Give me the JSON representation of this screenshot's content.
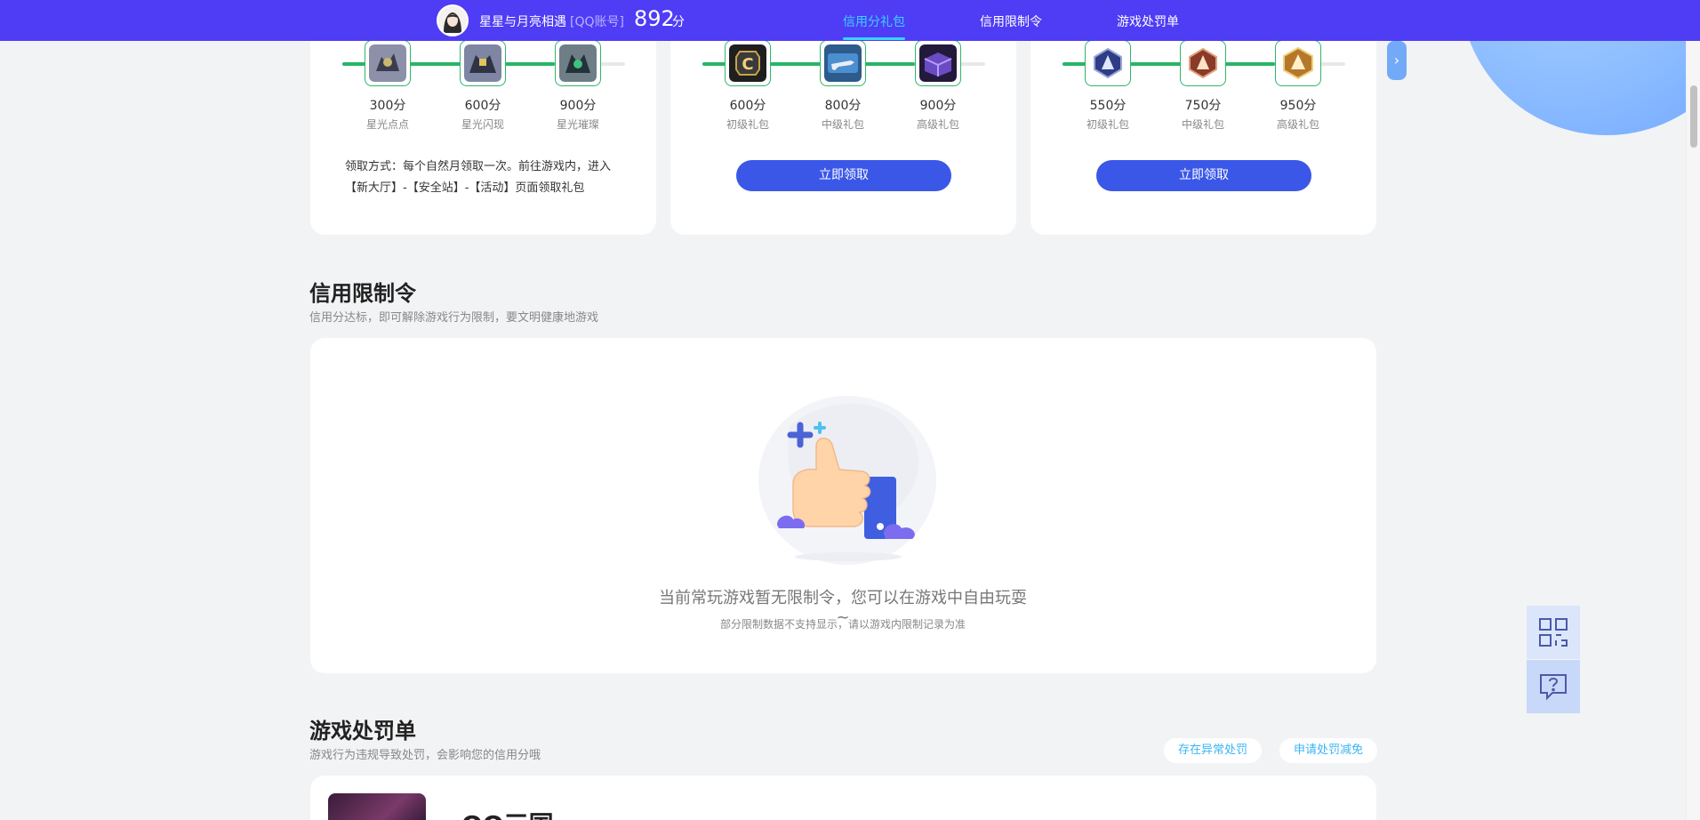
{
  "header": {
    "nickname": "星星与月亮相遇",
    "account_tag": "[QQ账号]",
    "score": "892",
    "score_unit": "分",
    "tabs": [
      {
        "label": "信用分礼包",
        "active": true
      },
      {
        "label": "信用限制令",
        "active": false
      },
      {
        "label": "游戏处罚单",
        "active": false
      }
    ]
  },
  "gift_cards": [
    {
      "items": [
        {
          "points": "300分",
          "label": "星光点点",
          "icon": "starlight-dot-icon",
          "color": "#6b6f85"
        },
        {
          "points": "600分",
          "label": "星光闪现",
          "icon": "starlight-flash-icon",
          "color": "#59607a"
        },
        {
          "points": "900分",
          "label": "星光璀璨",
          "icon": "starlight-dazzle-icon",
          "color": "#3f5a60"
        }
      ],
      "progress": 0.75,
      "note": "领取方式：每个自然月领取一次。前往游戏内，进入【新大厅】-【安全站】-【活动】页面领取礼包"
    },
    {
      "items": [
        {
          "points": "600分",
          "label": "初级礼包",
          "icon": "c-badge-icon",
          "color": "#2b2b2b"
        },
        {
          "points": "800分",
          "label": "中级礼包",
          "icon": "rifle-skin-icon",
          "color": "#2f6fa8"
        },
        {
          "points": "900分",
          "label": "高级礼包",
          "icon": "gift-crate-icon",
          "color": "#5a3f9a"
        }
      ],
      "progress": 0.75,
      "button": "立即领取"
    },
    {
      "items": [
        {
          "points": "550分",
          "label": "初级礼包",
          "icon": "blue-rank-badge-icon",
          "color": "#2f3c86"
        },
        {
          "points": "750分",
          "label": "中级礼包",
          "icon": "bronze-rank-badge-icon",
          "color": "#8a3a2a"
        },
        {
          "points": "950分",
          "label": "高级礼包",
          "icon": "gold-rank-badge-icon",
          "color": "#b5782b"
        }
      ],
      "progress": 0.75,
      "button": "立即领取"
    }
  ],
  "restriction": {
    "title": "信用限制令",
    "subtitle": "信用分达标，即可解除游戏行为限制，要文明健康地游戏",
    "empty_main": "当前常玩游戏暂无限制令，您可以在游戏中自由玩耍 ~",
    "empty_sub": "部分限制数据不支持显示，请以游戏内限制记录为准"
  },
  "penalty": {
    "title": "游戏处罚单",
    "subtitle": "游戏行为违规导致处罚，会影响您的信用分哦",
    "btn_abnormal": "存在异常处罚",
    "btn_reduce": "申请处罚减免",
    "game_name": "QQ三国"
  },
  "colors": {
    "topbar": "#4f3cf5",
    "active_tab": "#38d3ff",
    "progress": "#27b566",
    "button": "#3a57e8"
  }
}
